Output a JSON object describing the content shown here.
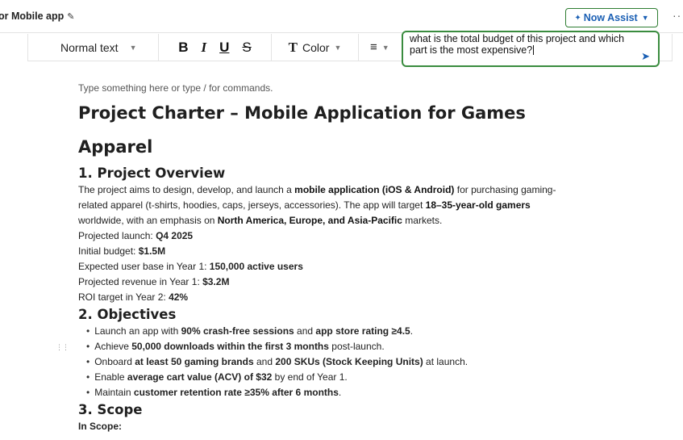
{
  "header": {
    "doc_title": "or Mobile app",
    "edit_icon": "pencil-icon",
    "now_assist_label": "Now Assist",
    "more_label": "···"
  },
  "toolbar": {
    "text_style": "Normal text",
    "bold": "B",
    "italic": "I",
    "underline": "U",
    "strike": "S",
    "color_icon": "T",
    "color_label": "Color",
    "align_icon": "≡"
  },
  "assist": {
    "query": "what is the total budget of this project and which part is the most expensive?",
    "send_icon": "send-icon"
  },
  "doc": {
    "placeholder": "Type something here or type / for commands.",
    "title": "Project Charter – Mobile Application for Games Apparel",
    "overview": {
      "heading": "1. Project Overview",
      "p1_a": "The project aims to design, develop, and launch a ",
      "p1_b": "mobile application (iOS & Android)",
      "p1_c": " for purchasing gaming-related apparel (t-shirts, hoodies, caps, jerseys, accessories). The app will target ",
      "p1_d": "18–35-year-old gamers",
      "p1_e": " worldwide, with an emphasis on ",
      "p1_f": "North America, Europe, and Asia-Pacific",
      "p1_g": " markets.",
      "launch_label": "Projected launch: ",
      "launch_value": "Q4 2025",
      "budget_label": "Initial budget: ",
      "budget_value": "$1.5M",
      "users_label": "Expected user base in Year 1: ",
      "users_value": "150,000 active users",
      "revenue_label": "Projected revenue in Year 1: ",
      "revenue_value": "$3.2M",
      "roi_label": "ROI target in Year 2: ",
      "roi_value": "42%"
    },
    "objectives": {
      "heading": "2. Objectives",
      "items": [
        {
          "a": "Launch an app with ",
          "b": "90% crash-free sessions",
          "c": " and ",
          "d": "app store rating ≥4.5",
          "e": "."
        },
        {
          "a": "Achieve ",
          "b": "50,000 downloads within the first 3 months",
          "c": " post-launch.",
          "d": "",
          "e": ""
        },
        {
          "a": "Onboard ",
          "b": "at least 50 gaming brands",
          "c": " and ",
          "d": "200 SKUs (Stock Keeping Units)",
          "e": " at launch."
        },
        {
          "a": "Enable ",
          "b": "average cart value (ACV) of $32",
          "c": " by end of Year 1.",
          "d": "",
          "e": ""
        },
        {
          "a": "Maintain ",
          "b": "customer retention rate ≥35% after 6 months",
          "c": ".",
          "d": "",
          "e": ""
        }
      ]
    },
    "scope": {
      "heading": "3. Scope",
      "in_scope": "In Scope:"
    }
  }
}
